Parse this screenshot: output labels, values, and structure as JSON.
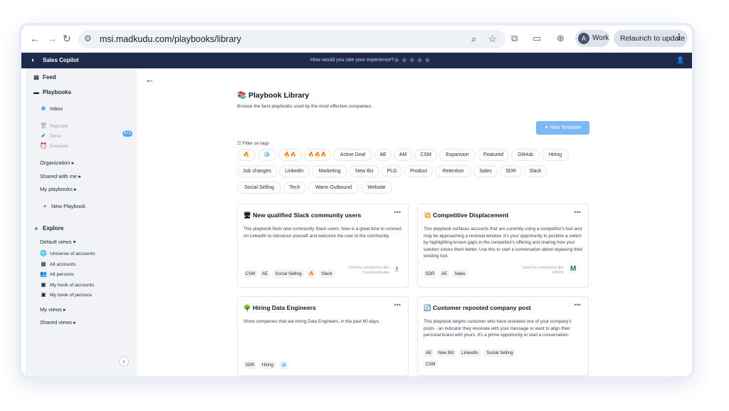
{
  "browser": {
    "url": "msi.madkudu.com/playbooks/library",
    "profile_initial": "A",
    "profile_label": "Work",
    "relaunch_label": "Relaunch to update"
  },
  "appbar": {
    "app_name": "Sales Copilot",
    "rating_question": "How would you rate your experience?",
    "stars": "★★★★★"
  },
  "sidebar": {
    "feed": "Feed",
    "playbooks": "Playbooks",
    "inbox": "Inbox",
    "inbox_count": "671",
    "rejected": "Rejected",
    "done": "Done",
    "snoozed": "Snoozed",
    "organization": "Organization",
    "shared_with_me": "Shared with me",
    "my_playbooks": "My playbooks",
    "new_playbook": "New Playbook",
    "explore": "Explore",
    "default_views": "Default views",
    "universe": "Universe of accounts",
    "all_accounts": "All accounts",
    "all_persons": "All persons",
    "my_book_accounts": "My book of accounts",
    "my_book_persons": "My book of persons",
    "my_views": "My views",
    "shared_views": "Shared views"
  },
  "main": {
    "title": "Playbook Library",
    "subtitle": "Browse the best playbooks used by the most effective companies.",
    "new_template": "New Template",
    "filter_label": "Filter on tags",
    "tags": [
      "🔥",
      "🧊",
      "🔥🔥",
      "🔥🔥🔥",
      "Active Deal",
      "AE",
      "AM",
      "CSM",
      "Expansion",
      "Featured",
      "GitHub",
      "Hiring",
      "Job changes",
      "LinkedIn",
      "Marketing",
      "New Biz",
      "PLG",
      "Product",
      "Retention",
      "Sales",
      "SDR",
      "Slack",
      "Social Selling",
      "Tech",
      "Warm Outbound",
      "Website"
    ]
  },
  "cards": [
    {
      "icon": "🖥",
      "title": "New qualified Slack community users",
      "desc": "This playbook finds new community Slack users. Now is a great time to connect on LinkedIn to introduce yourself and welcome the user to the community.",
      "tags": [
        "CSM",
        "AE",
        "Social Selling",
        "🔥",
        "Slack"
      ],
      "used_by": "Used by companies like CockroachLabs"
    },
    {
      "icon": "💥",
      "title": "Competitive Displacement",
      "desc": "This playbook surfaces accounts that are currently using a competitor's tool and may be approaching a renewal window. It's your opportunity to position a switch by highlighting known gaps in the competitor's offering and sharing how your solution solves them better. Use this to start a conversation about replacing their existing tool.",
      "tags": [
        "SDR",
        "AE",
        "Sales"
      ],
      "used_by": "Used by companies like MNTN"
    },
    {
      "icon": "🌳",
      "title": "Hiring Data Engineers",
      "desc": "Show companies that are hiring Data Engineers, in the past 60 days.",
      "tags": [
        "SDR",
        "Hiring",
        "🧊"
      ]
    },
    {
      "icon": "🔄",
      "title": "Customer reposted company post",
      "desc": "This playbook targets customer who have reshared one of your company's posts - an indicator they resonate with your message or want to align their personal brand with yours. It's a prime opportunity to start a conversation.",
      "tags": [
        "AE",
        "New Biz",
        "LinkedIn",
        "Social Selling",
        "CSM"
      ]
    }
  ]
}
